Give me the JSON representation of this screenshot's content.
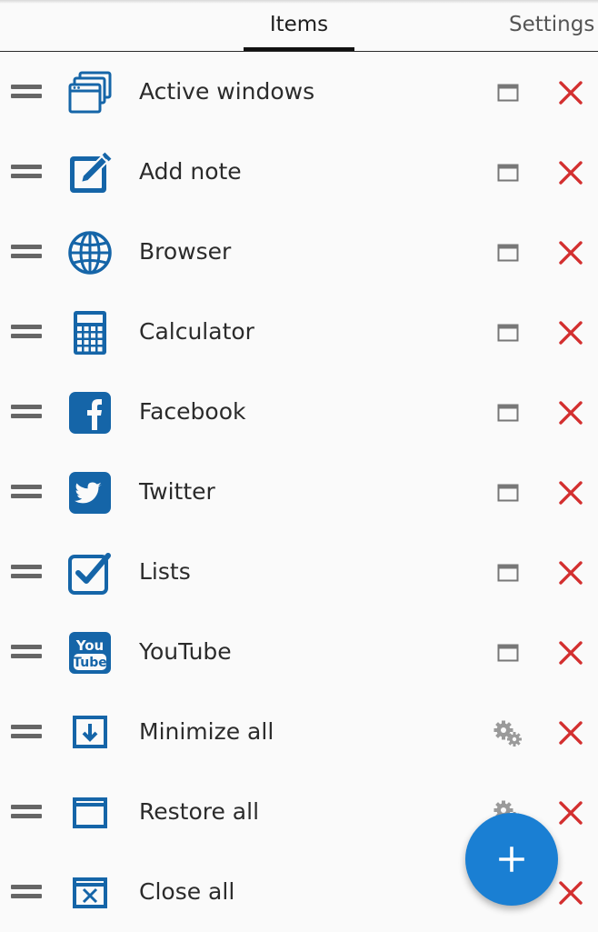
{
  "tabs": [
    {
      "label": "Items",
      "selected": true
    },
    {
      "label": "Settings",
      "selected": false
    }
  ],
  "colors": {
    "accent": "#1a7fd3",
    "icon_blue": "#1565a8",
    "delete_red": "#d32f2f",
    "handle_gray": "#666666"
  },
  "items": [
    {
      "label": "Active windows",
      "icon": "windows-icon",
      "action": "window-icon"
    },
    {
      "label": "Add note",
      "icon": "note-edit-icon",
      "action": "window-icon"
    },
    {
      "label": "Browser",
      "icon": "globe-icon",
      "action": "window-icon"
    },
    {
      "label": "Calculator",
      "icon": "calculator-icon",
      "action": "window-icon"
    },
    {
      "label": "Facebook",
      "icon": "facebook-icon",
      "action": "window-icon"
    },
    {
      "label": "Twitter",
      "icon": "twitter-icon",
      "action": "window-icon"
    },
    {
      "label": "Lists",
      "icon": "checkbox-icon",
      "action": "window-icon"
    },
    {
      "label": "YouTube",
      "icon": "youtube-icon",
      "action": "window-icon"
    },
    {
      "label": "Minimize all",
      "icon": "minimize-all-icon",
      "action": "gear-icon"
    },
    {
      "label": "Restore all",
      "icon": "restore-all-icon",
      "action": "gear-icon"
    },
    {
      "label": "Close all",
      "icon": "close-all-icon",
      "action": "gear-icon"
    }
  ],
  "fab": {
    "icon": "plus-icon"
  }
}
